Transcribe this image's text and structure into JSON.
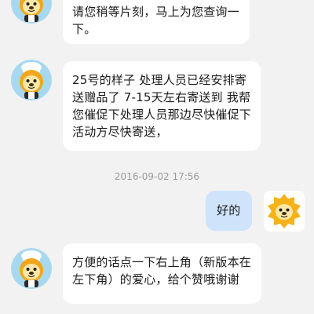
{
  "messages": [
    {
      "id": "m1",
      "from": "agent",
      "lines": [
        "请您稍等片刻，马上为您查询一",
        "下。"
      ]
    },
    {
      "id": "m2",
      "from": "agent",
      "lines": [
        "25号的样子 处理人员已经安排寄",
        "送赠品了 7-15天左右寄送到 我帮",
        "您催促下处理人员那边尽快催促下",
        "活动方尽快寄送，"
      ]
    },
    {
      "id": "ts1",
      "type": "timestamp",
      "text": "2016-09-02 17:56"
    },
    {
      "id": "m3",
      "from": "user",
      "lines": [
        "好的"
      ]
    },
    {
      "id": "m4",
      "from": "agent",
      "lines": [
        "方便的话点一下右上角（新版本在",
        "左下角）的爱心，给个赞哦谢谢"
      ]
    }
  ],
  "colors": {
    "background": "#f2f2f2",
    "agent_bubble": "#ffffff",
    "user_bubble": "#cfe4fb",
    "agent_avatar_ring": "#9fd6f0",
    "user_avatar_bg": "#ffffff",
    "mascot_yellow": "#f6b21b"
  },
  "icons": {
    "agent_avatar": "chef-lion-mascot-icon",
    "user_avatar": "lion-mascot-icon"
  }
}
